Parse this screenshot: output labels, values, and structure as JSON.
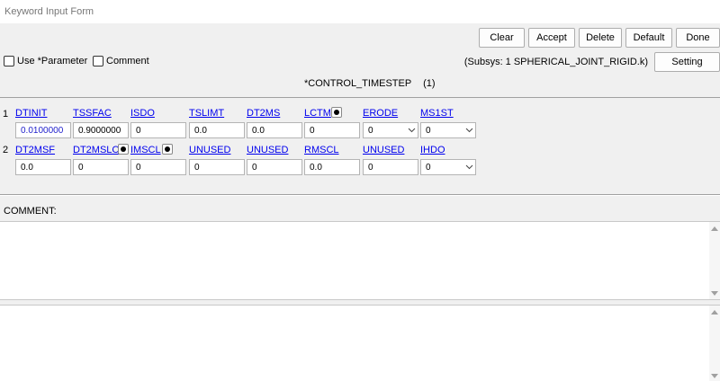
{
  "window": {
    "title": "Keyword Input Form"
  },
  "toolbar": {
    "clear_label": "Clear",
    "accept_label": "Accept",
    "delete_label": "Delete",
    "default_label": "Default",
    "done_label": "Done",
    "setting_label": "Setting"
  },
  "options": {
    "use_parameter_label": "Use *Parameter",
    "comment_label": "Comment"
  },
  "subsys_text": "(Subsys: 1 SPHERICAL_JOINT_RIGID.k)",
  "keyword_title": "*CONTROL_TIMESTEP",
  "keyword_count": "(1)",
  "rows": [
    {
      "number": "1",
      "fields": [
        {
          "label": "DTINIT",
          "value": "0.0100000",
          "type": "text"
        },
        {
          "label": "TSSFAC",
          "value": "0.9000000",
          "type": "text"
        },
        {
          "label": "ISDO",
          "value": "0",
          "type": "text"
        },
        {
          "label": "TSLIMT",
          "value": "0.0",
          "type": "text"
        },
        {
          "label": "DT2MS",
          "value": "0.0",
          "type": "text"
        },
        {
          "label": "LCTM",
          "value": "0",
          "type": "text"
        },
        {
          "label": "ERODE",
          "value": "0",
          "type": "select"
        },
        {
          "label": "MS1ST",
          "value": "0",
          "type": "select"
        }
      ]
    },
    {
      "number": "2",
      "fields": [
        {
          "label": "DT2MSF",
          "value": "0.0",
          "type": "text"
        },
        {
          "label": "DT2MSLC",
          "value": "0",
          "type": "text"
        },
        {
          "label": "IMSCL",
          "value": "0",
          "type": "text"
        },
        {
          "label": "UNUSED",
          "value": "0",
          "type": "text"
        },
        {
          "label": "UNUSED",
          "value": "0",
          "type": "text"
        },
        {
          "label": "RMSCL",
          "value": "0.0",
          "type": "text"
        },
        {
          "label": "UNUSED",
          "value": "0",
          "type": "text"
        },
        {
          "label": "IHDO",
          "value": "0",
          "type": "select"
        }
      ]
    }
  ],
  "comment_section": {
    "label": "COMMENT:"
  }
}
